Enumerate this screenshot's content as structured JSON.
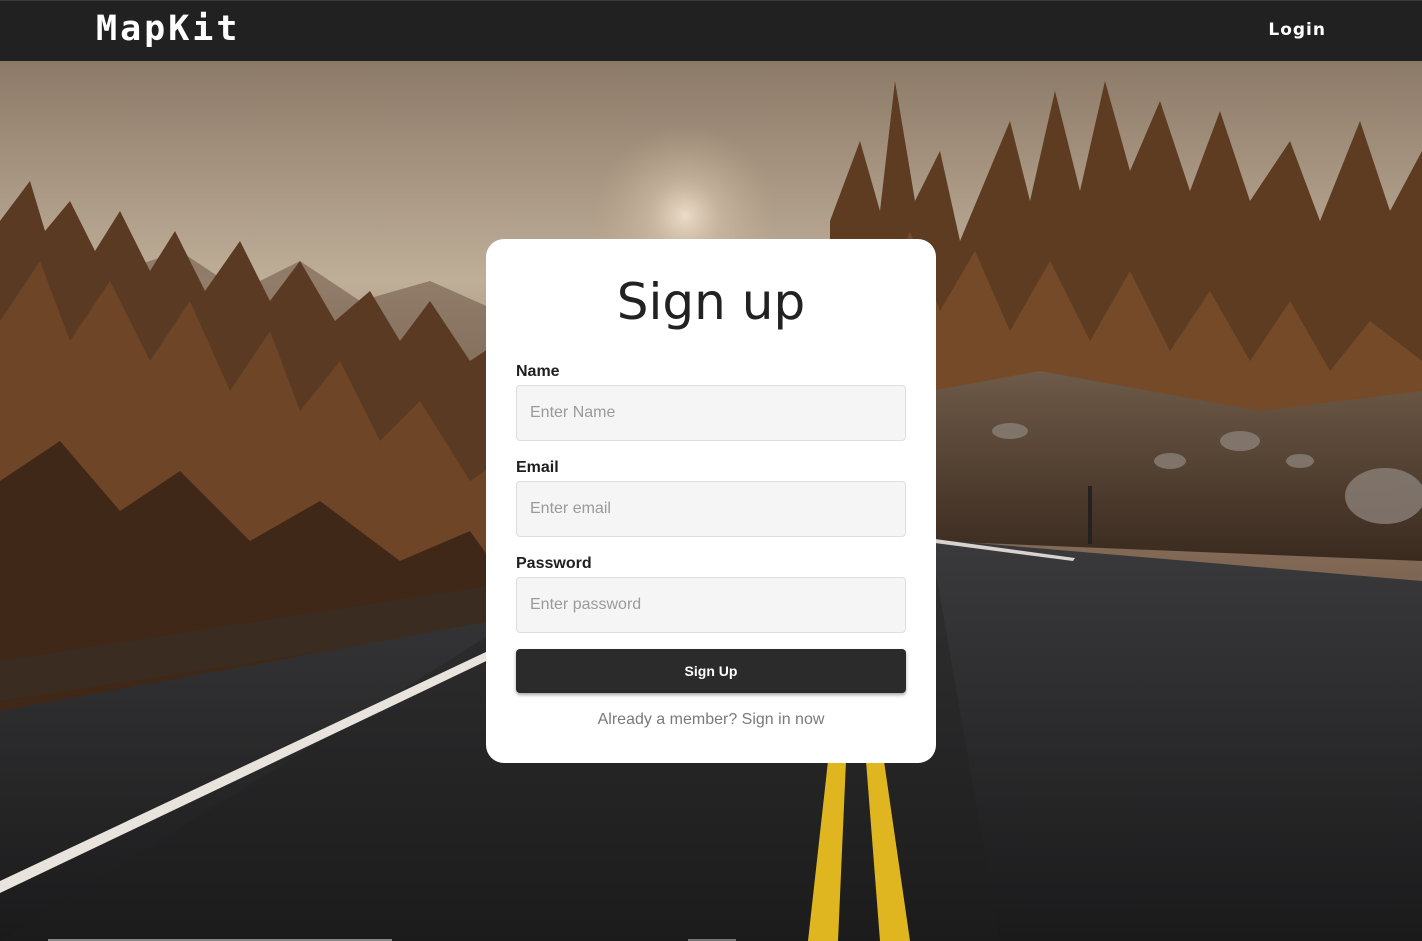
{
  "navbar": {
    "brand": "MapKit",
    "login_label": "Login"
  },
  "background": {
    "description_icon": "forest-road-photo"
  },
  "signup": {
    "title": "Sign up",
    "fields": {
      "name": {
        "label": "Name",
        "placeholder": "Enter Name",
        "value": ""
      },
      "email": {
        "label": "Email",
        "placeholder": "Enter email",
        "value": ""
      },
      "password": {
        "label": "Password",
        "placeholder": "Enter password",
        "value": ""
      }
    },
    "submit_label": "Sign Up",
    "signin_text": "Already a member? Sign in now"
  },
  "colors": {
    "navbar_bg": "#212121",
    "button_bg": "#2b2b2b",
    "input_bg": "#f5f5f5"
  }
}
